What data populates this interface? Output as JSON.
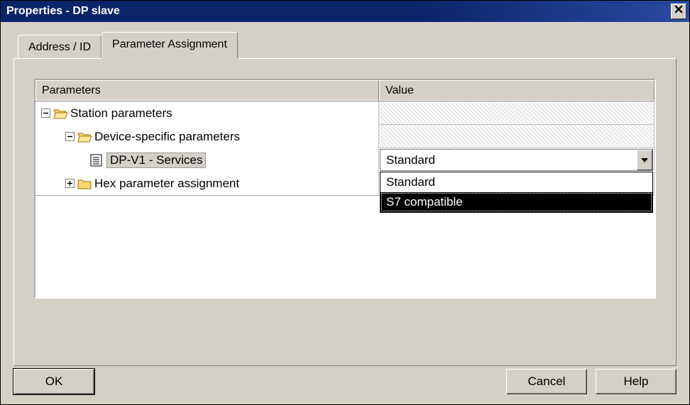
{
  "window": {
    "title": "Properties - DP slave"
  },
  "tabs": [
    {
      "label": "Address / ID",
      "active": false
    },
    {
      "label": "Parameter Assignment",
      "active": true
    }
  ],
  "grid": {
    "headers": {
      "parameters": "Parameters",
      "value": "Value"
    },
    "rows": [
      {
        "label": "Station parameters",
        "level": 1,
        "expander": "minus",
        "icon": "folder-open",
        "value_hatched": true
      },
      {
        "label": "Device-specific parameters",
        "level": 2,
        "expander": "minus",
        "icon": "folder-open",
        "value_hatched": true
      },
      {
        "label": "DP-V1 - Services",
        "level": 3,
        "expander": null,
        "icon": "doc",
        "selected": true,
        "value_dropdown": true
      },
      {
        "label": "Hex parameter assignment",
        "level": 2,
        "expander": "plus",
        "icon": "folder-closed"
      }
    ]
  },
  "dropdown": {
    "selected": "Standard",
    "options": [
      "Standard",
      "S7 compatible"
    ],
    "highlighted_index": 1
  },
  "buttons": {
    "ok": "OK",
    "cancel": "Cancel",
    "help": "Help"
  }
}
